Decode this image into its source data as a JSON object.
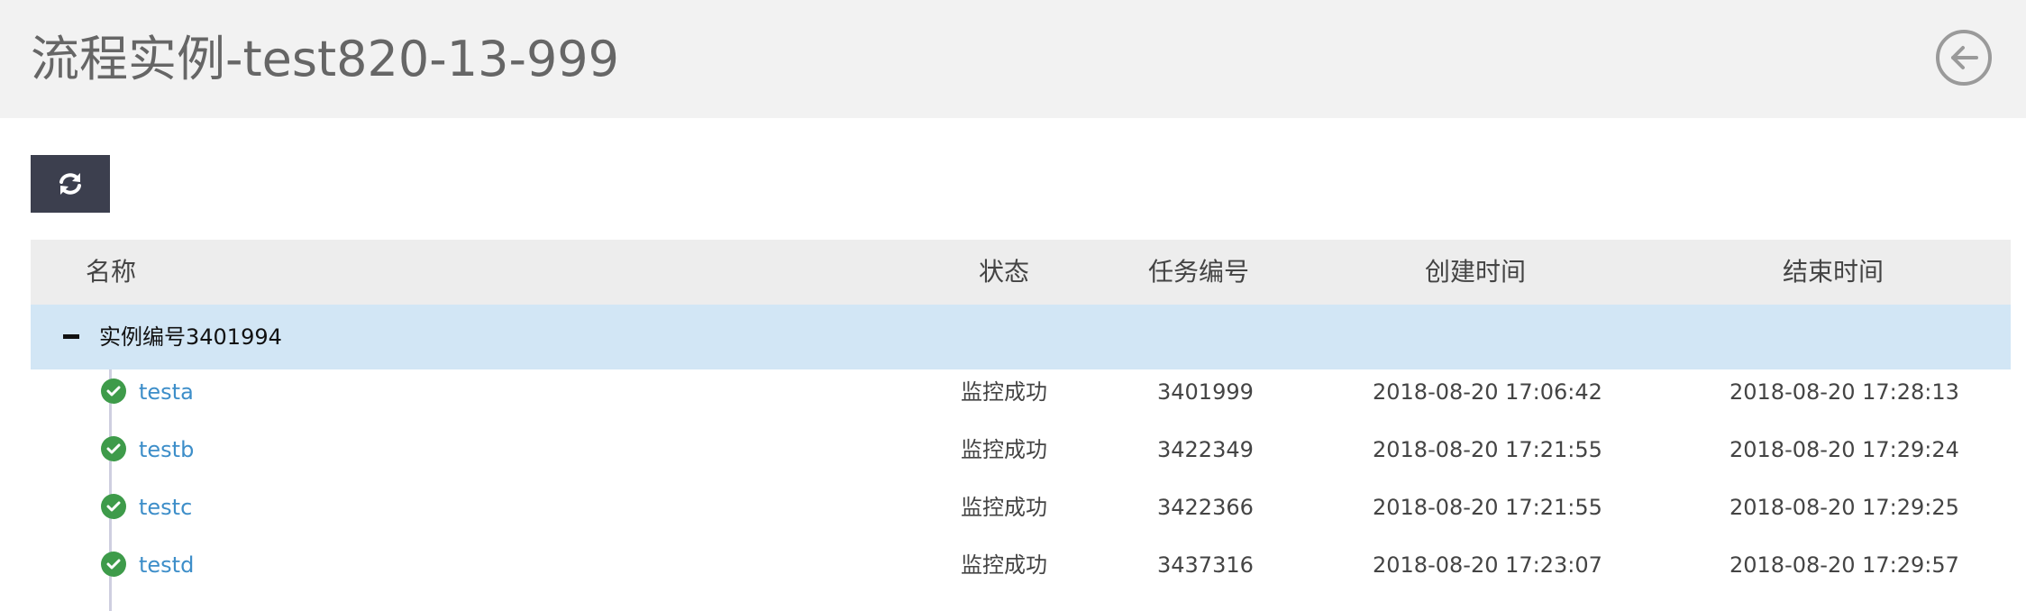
{
  "page": {
    "title": "流程实例-test820-13-999",
    "back_icon": "arrow-left-circle-icon",
    "refresh_icon": "refresh-icon"
  },
  "table": {
    "columns": [
      "名称",
      "状态",
      "任务编号",
      "创建时间",
      "结束时间"
    ],
    "group": {
      "label": "实例编号3401994",
      "expanded": true
    },
    "rows": [
      {
        "name": "testa",
        "status": "监控成功",
        "task_no": "3401999",
        "created": "2018-08-20 17:06:42",
        "ended": "2018-08-20 17:28:13"
      },
      {
        "name": "testb",
        "status": "监控成功",
        "task_no": "3422349",
        "created": "2018-08-20 17:21:55",
        "ended": "2018-08-20 17:29:24"
      },
      {
        "name": "testc",
        "status": "监控成功",
        "task_no": "3422366",
        "created": "2018-08-20 17:21:55",
        "ended": "2018-08-20 17:29:25"
      },
      {
        "name": "testd",
        "status": "监控成功",
        "task_no": "3437316",
        "created": "2018-08-20 17:23:07",
        "ended": "2018-08-20 17:29:57"
      }
    ]
  },
  "colors": {
    "header_bg": "#f2f2f2",
    "group_bg": "#d2e6f5",
    "success": "#3e9b4a",
    "link": "#3d8ec9",
    "button_dark": "#3c3f4e"
  }
}
